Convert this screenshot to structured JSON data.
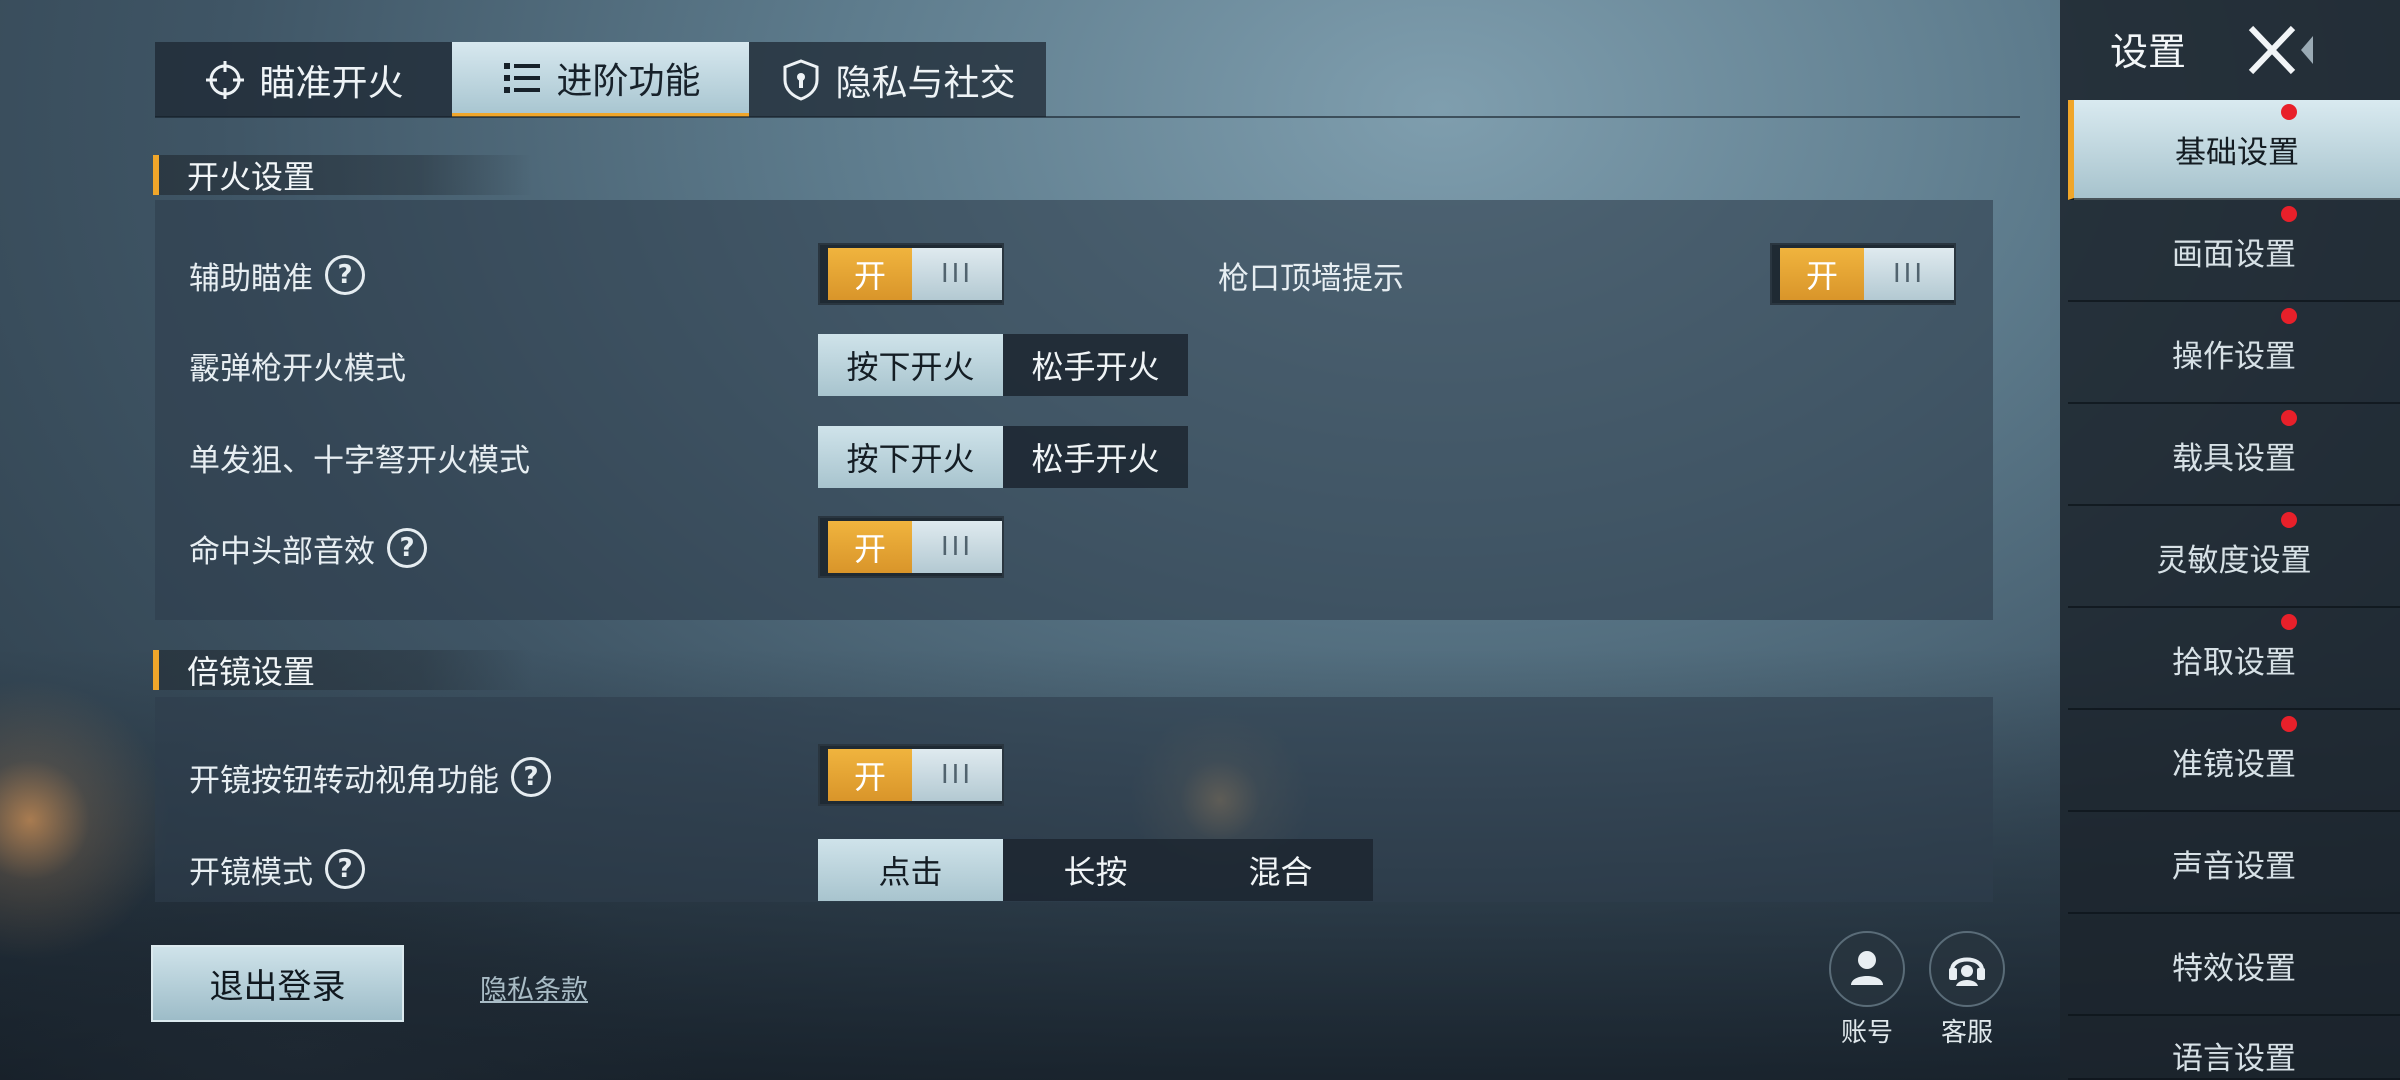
{
  "tabs": [
    {
      "label": "瞄准开火",
      "icon": "crosshair-icon"
    },
    {
      "label": "进阶功能",
      "icon": "list-icon",
      "active": true
    },
    {
      "label": "隐私与社交",
      "icon": "shield-icon"
    }
  ],
  "fire_section": {
    "title": "开火设置",
    "aim_assist": {
      "label": "辅助瞄准",
      "state": "开"
    },
    "muzzle_wall": {
      "label": "枪口顶墙提示",
      "state": "开"
    },
    "shotgun_mode": {
      "label": "霰弹枪开火模式",
      "options": [
        "按下开火",
        "松手开火"
      ],
      "selected": "按下开火"
    },
    "sniper_mode": {
      "label": "单发狙、十字弩开火模式",
      "options": [
        "按下开火",
        "松手开火"
      ],
      "selected": "按下开火"
    },
    "headshot_sound": {
      "label": "命中头部音效",
      "state": "开"
    }
  },
  "scope_section": {
    "title": "倍镜设置",
    "scope_button_view": {
      "label": "开镜按钮转动视角功能",
      "state": "开"
    },
    "scope_mode": {
      "label": "开镜模式",
      "options": [
        "点击",
        "长按",
        "混合"
      ],
      "selected": "点击"
    }
  },
  "toggle_knob": "III",
  "help_glyph": "?",
  "bottom": {
    "logout": "退出登录",
    "privacy": "隐私条款",
    "account": "账号",
    "service": "客服"
  },
  "sidebar": {
    "title": "设置",
    "items": [
      {
        "label": "基础设置",
        "active": true,
        "badge": true
      },
      {
        "label": "画面设置",
        "badge": true
      },
      {
        "label": "操作设置",
        "badge": true
      },
      {
        "label": "载具设置",
        "badge": true
      },
      {
        "label": "灵敏度设置",
        "badge": true
      },
      {
        "label": "拾取设置",
        "badge": true
      },
      {
        "label": "准镜设置",
        "badge": true
      },
      {
        "label": "声音设置",
        "badge": false
      },
      {
        "label": "特效设置",
        "badge": false
      },
      {
        "label": "语言设置",
        "badge": false
      }
    ]
  },
  "colors": {
    "accent": "#f0a62a",
    "badge": "#e8202a"
  }
}
